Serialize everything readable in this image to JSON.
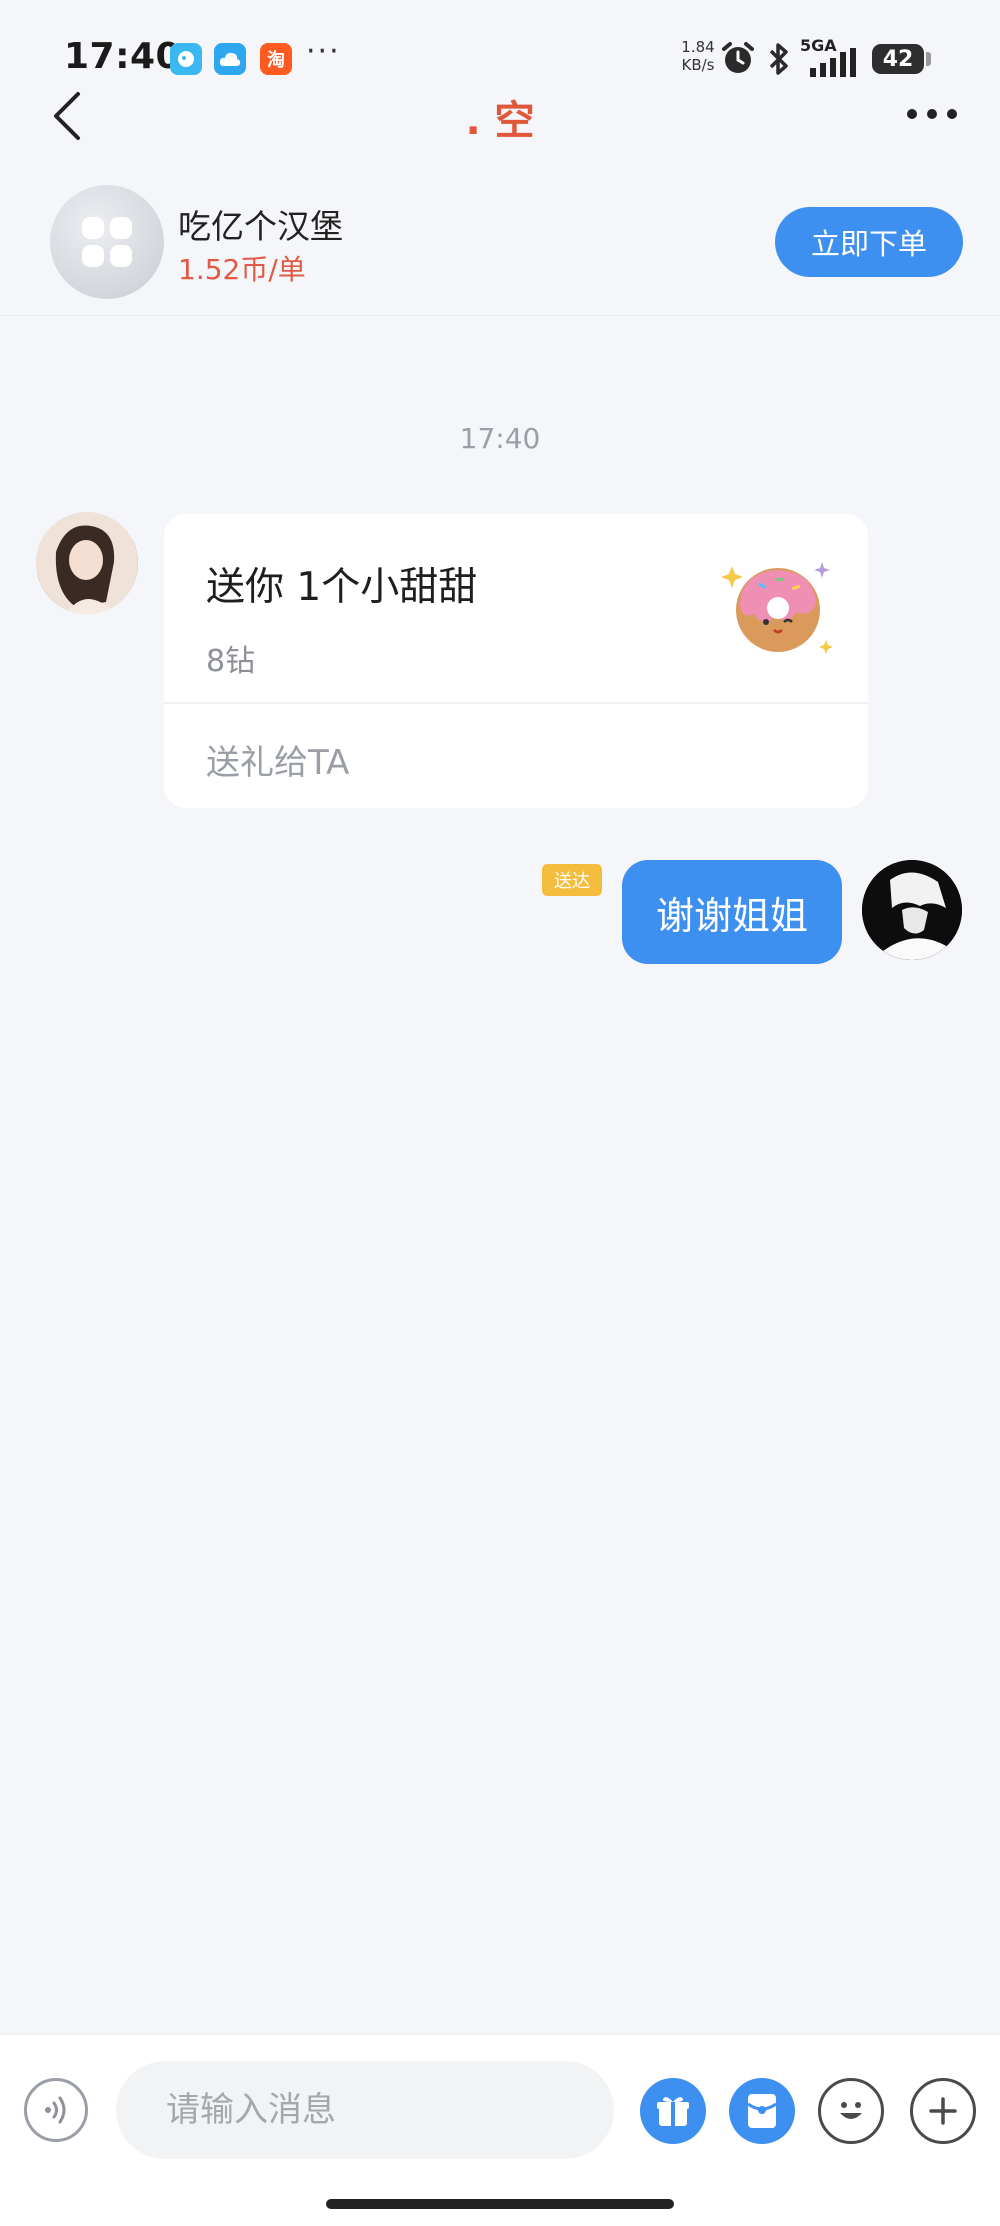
{
  "status_bar": {
    "time": "17:40",
    "app_badges": [
      {
        "name": "bubble-app-icon",
        "glyph": "◕",
        "color": "#3cb8f0"
      },
      {
        "name": "cloud-app-icon",
        "glyph": "☁",
        "color": "#2fa7f0"
      },
      {
        "name": "taobao-app-icon",
        "glyph": "淘",
        "color": "#ff5a1f"
      }
    ],
    "more": "···",
    "net_speed_value": "1.84",
    "net_speed_unit": "KB/s",
    "signal_label": "5GA",
    "battery": "42"
  },
  "nav": {
    "title": ". 空"
  },
  "order_bar": {
    "name": "吃亿个汉堡",
    "price": "1.52币/单",
    "button_label": "立即下单"
  },
  "chat": {
    "timestamp": "17:40",
    "gift": {
      "title": "送你 1个小甜甜",
      "price": "8钻",
      "action": "送礼给TA"
    },
    "my_message": {
      "status": "送达",
      "text": "谢谢姐姐"
    }
  },
  "composer": {
    "placeholder": "请输入消息"
  },
  "colors": {
    "accent": "#3d8ff0",
    "price_red": "#e25a45",
    "title_red": "#e0573a",
    "delivered_badge": "#f5bd3d",
    "background": "#f4f6fa"
  }
}
